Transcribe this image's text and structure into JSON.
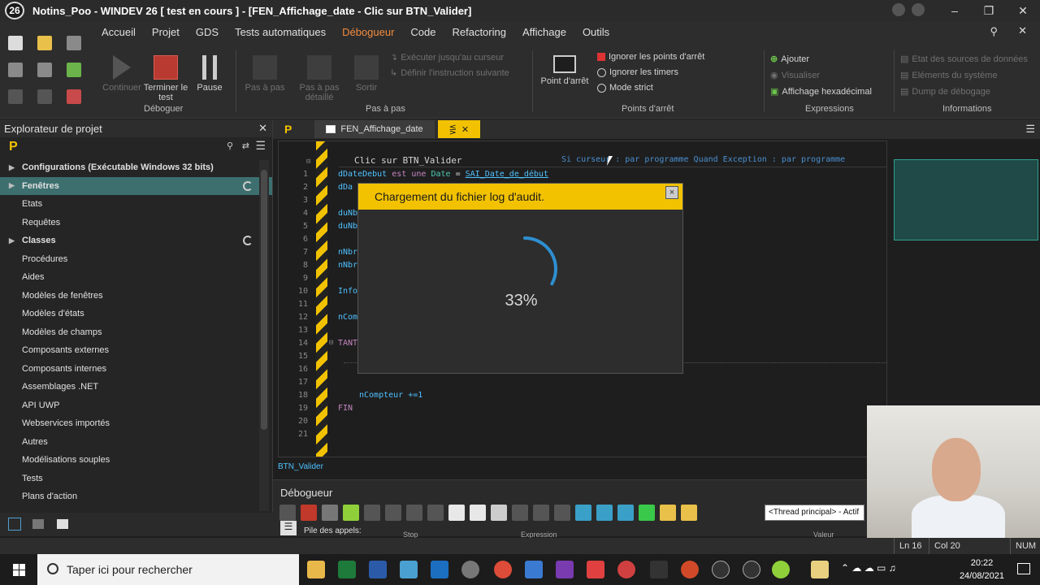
{
  "window": {
    "logo": "26",
    "title": "Notins_Poo - WINDEV 26 [ test en cours ] - [FEN_Affichage_date - Clic sur BTN_Valider]"
  },
  "menu": [
    "Accueil",
    "Projet",
    "GDS",
    "Tests automatiques",
    "Débogueur",
    "Code",
    "Refactoring",
    "Affichage",
    "Outils"
  ],
  "ribbon": {
    "debug": {
      "continue": "Continuer",
      "stop": "Terminer le test",
      "pause": "Pause",
      "group": "Déboguer"
    },
    "step": {
      "step": "Pas à pas",
      "step_detail": "Pas à pas détaillé",
      "out": "Sortir",
      "run_to_cursor": "Exécuter jusqu'au curseur",
      "define_next": "Définir l'instruction suivante",
      "group": "Pas à pas"
    },
    "breakpoints": {
      "point": "Point d'arrêt",
      "ignore_bp": "Ignorer les points d'arrêt",
      "ignore_timers": "Ignorer les timers",
      "strict": "Mode strict",
      "group": "Points d'arrêt"
    },
    "expressions": {
      "add": "Ajouter",
      "view": "Visualiser",
      "hex": "Affichage hexadécimal",
      "group": "Expressions"
    },
    "info": {
      "sources": "Etat des sources de données",
      "system": "Eléments du système",
      "dump": "Dump de débogage",
      "group": "Informations"
    }
  },
  "explorer": {
    "title": "Explorateur de projet",
    "items": [
      {
        "label": "Configurations (Exécutable Windows 32 bits)",
        "bold": true,
        "arrow": true
      },
      {
        "label": "Fenêtres",
        "bold": true,
        "arrow": true,
        "selected": true,
        "spinner": true
      },
      {
        "label": "Etats"
      },
      {
        "label": "Requêtes"
      },
      {
        "label": "Classes",
        "bold": true,
        "arrow": true,
        "spinner": true
      },
      {
        "label": "Procédures"
      },
      {
        "label": "Aides"
      },
      {
        "label": "Modèles de fenêtres"
      },
      {
        "label": "Modèles d'états"
      },
      {
        "label": "Modèles de champs"
      },
      {
        "label": "Composants externes"
      },
      {
        "label": "Composants internes"
      },
      {
        "label": "Assemblages .NET"
      },
      {
        "label": "API UWP"
      },
      {
        "label": "Webservices importés"
      },
      {
        "label": "Autres"
      },
      {
        "label": "Modélisations souples"
      },
      {
        "label": "Tests"
      },
      {
        "label": "Plans d'action"
      }
    ]
  },
  "editor": {
    "tab_label": "FEN_Affichage_date",
    "event_title": "Clic sur BTN_Valider",
    "event_info": "Si curseur : par programme  Quand Exception : par programme",
    "line_numbers": [
      "1",
      "2",
      "3",
      "4",
      "5",
      "6",
      "7",
      "8",
      "9",
      "10",
      "11",
      "12",
      "13",
      "14",
      "15",
      "16",
      "17",
      "18",
      "19",
      "20",
      "21"
    ],
    "code": {
      "l1_var": "dDateDebut",
      "l1_kw": "est une",
      "l1_type": "Date",
      "l1_eq": "=",
      "l1_val": "SAI_Date_de_début",
      "l2": "dDa",
      "l4": "duNb",
      "l5": "duNb",
      "l7": "nNbr",
      "l8": "nNbr",
      "l10": "Info",
      "l12": "nCom",
      "l14": "TANT",
      "l18": "nCompteur +=1",
      "l19": "FIN"
    }
  },
  "dialog": {
    "title": "Chargement du fichier log d'audit.",
    "progress_label": "33%",
    "progress": 0.33,
    "close": "×"
  },
  "debugger": {
    "context_label": "BTN_Valider",
    "title": "Débogueur",
    "thread": "<Thread principal> - Actif",
    "stack_label": "Pile des appels:",
    "col_stop": "Stop",
    "col_expr": "Expression",
    "col_value": "Valeur"
  },
  "status": {
    "line": "Ln 16",
    "col": "Col 20",
    "num": "NUM"
  },
  "taskbar": {
    "search_placeholder": "Taper ici pour rechercher",
    "time": "20:22",
    "date": "24/08/2021"
  },
  "colors": {
    "accent": "#f2c200",
    "debug_tab": "#f28b3e",
    "selection": "#3d6f6f",
    "stop_red": "#c0392b"
  }
}
